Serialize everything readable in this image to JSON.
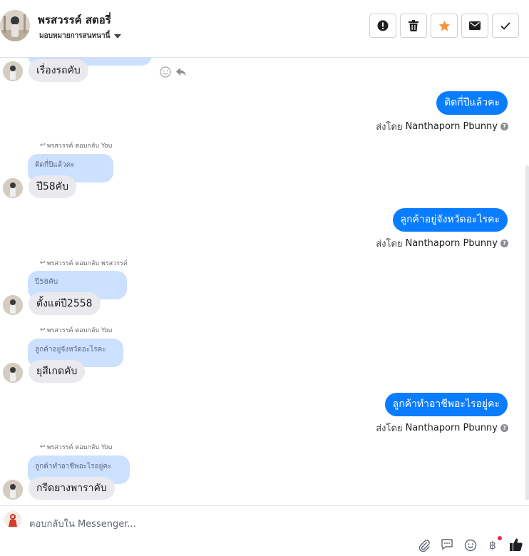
{
  "header": {
    "name": "พรสวรรค์ สตอรี่",
    "assign_label": "มอบหมายการสนทนานี้",
    "buttons": [
      {
        "name": "report-button",
        "icon": "exclamation-icon"
      },
      {
        "name": "delete-button",
        "icon": "trash-icon"
      },
      {
        "name": "star-button",
        "icon": "star-icon"
      },
      {
        "name": "mark-unread-button",
        "icon": "envelope-icon"
      },
      {
        "name": "mark-done-button",
        "icon": "checkmark-icon"
      }
    ]
  },
  "messages": {
    "m1": {
      "text": "เรื่องรถคับ"
    },
    "m2": {
      "text": "ติดกี่ปีแล้วคะ",
      "sent_by_label": "ส่งโดย",
      "sender": "Nanthaporn Pbunny"
    },
    "m3": {
      "reply_label": "พรสวรรค์ ตอบกลับ You",
      "quote": "ติดกี่ปีแล้วคะ",
      "text": "ปี58คับ"
    },
    "m4": {
      "text": "ลูกค้าอยู่จังหวัดอะไรคะ",
      "sent_by_label": "ส่งโดย",
      "sender": "Nanthaporn Pbunny"
    },
    "m5": {
      "reply_label": "พรสวรรค์ ตอบกลับ พรสวรรค์",
      "quote": "ปี58คับ",
      "text": "ตั้งแต่ปี2558"
    },
    "m6": {
      "reply_label": "พรสวรรค์ ตอบกลับ You",
      "quote": "ลูกค้าอยู่จังหวัดอะไรคะ",
      "text": "ยุสีเกดคับ"
    },
    "m7": {
      "text": "ลูกค้าทำอาชีพอะไรอยู่คะ",
      "sent_by_label": "ส่งโดย",
      "sender": "Nanthaporn Pbunny"
    },
    "m8": {
      "reply_label": "พรสวรรค์ ตอบกลับ You",
      "quote": "ลูกค้าทำอาชีพอะไรอยู่คะ",
      "text": "กรีดยางพาราคับ"
    }
  },
  "composer": {
    "placeholder": "ตอบกลับใน Messenger..."
  },
  "colors": {
    "outgoing_bubble": "#0a7cff",
    "incoming_bubble": "#e9e9ee",
    "quote_bubble": "#cce0ff",
    "star": "#f7923b",
    "notification_dot": "#f02849"
  }
}
